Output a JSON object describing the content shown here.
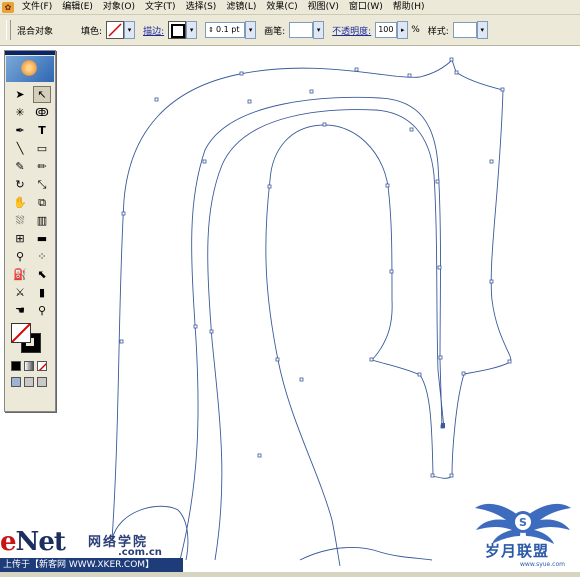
{
  "menubar": {
    "items": [
      "文件(F)",
      "编辑(E)",
      "对象(O)",
      "文字(T)",
      "选择(S)",
      "滤镜(L)",
      "效果(C)",
      "视图(V)",
      "窗口(W)",
      "帮助(H)"
    ]
  },
  "control": {
    "mode_label": "混合对象",
    "fill_label": "填色:",
    "stroke_label": "描边:",
    "stroke_weight": "0.1 pt",
    "brush_label": "画笔:",
    "opacity_label": "不透明度:",
    "opacity_value": "100",
    "opacity_unit": "%",
    "style_label": "样式:"
  },
  "toolbox": {
    "tools": [
      "selection-arrow",
      "direct-select-arrow",
      "magic-wand",
      "lasso",
      "pen",
      "type",
      "line",
      "rectangle",
      "paintbrush",
      "pencil",
      "rotate",
      "scale",
      "warp",
      "free-transform",
      "symbol-sprayer",
      "graph",
      "mesh",
      "gradient",
      "eyedropper",
      "blend",
      "live-paint",
      "live-paint-select",
      "slice",
      "eraser",
      "hand",
      "zoom"
    ],
    "selected_tool": "direct-select-arrow"
  },
  "watermark": {
    "enet_e": "e",
    "enet_rest": "Net",
    "enet_cn": "网络学院",
    "enet_url": ".com.cn",
    "footer": "上传于【新客网 WWW.XKER.COM】",
    "logo_letter": "S",
    "logo_text": "岁月联盟",
    "logo_sub": "www.syue.com"
  },
  "colors": {
    "ui_bg": "#ece9d8",
    "path_stroke": "#3a5a9c",
    "anchor_fill": "#ffffff"
  }
}
